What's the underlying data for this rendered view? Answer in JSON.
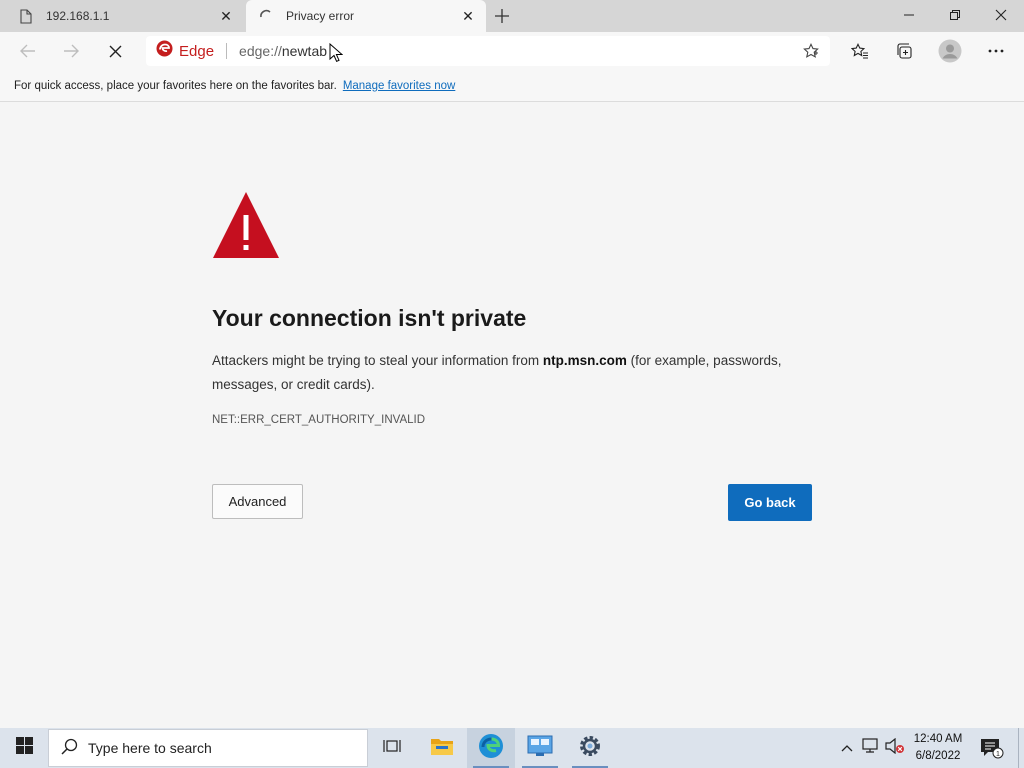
{
  "tabs": [
    {
      "title": "192.168.1.1",
      "icon": "page-icon"
    },
    {
      "title": "Privacy error",
      "icon": "loading-spinner-icon",
      "active": true
    }
  ],
  "address": {
    "brand": "Edge",
    "url_prefix": "edge://",
    "url_rest": "newtab"
  },
  "favorites_bar": {
    "message": "For quick access, place your favorites here on the favorites bar.",
    "link": "Manage favorites now"
  },
  "error_page": {
    "heading": "Your connection isn't private",
    "desc_before": "Attackers might be trying to steal your information from ",
    "domain": "ntp.msn.com",
    "desc_after": " (for example, passwords, messages, or credit cards).",
    "error_code": "NET::ERR_CERT_AUTHORITY_INVALID",
    "advanced_label": "Advanced",
    "goback_label": "Go back",
    "accent_color": "#0f6cbd",
    "warning_color": "#c50f1f"
  },
  "taskbar": {
    "search_placeholder": "Type here to search",
    "time": "12:40 AM",
    "date": "6/8/2022"
  }
}
